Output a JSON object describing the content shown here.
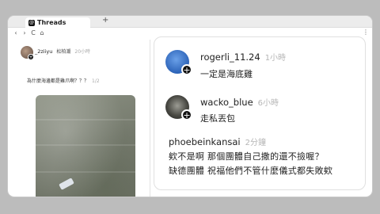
{
  "browser": {
    "tab_title": "Threads",
    "tab_icon": "@",
    "new_tab": "+",
    "nav": [
      "‹",
      "›",
      "C",
      "⌂"
    ],
    "menu": "⋮"
  },
  "post": {
    "username": "_2ziiyu",
    "tag": "松柏潮",
    "time": "20小時",
    "text": "為什麼海邊都是雞爪啊？？？",
    "page": "1/2"
  },
  "comments": [
    {
      "username": "rogerli_11.24",
      "time": "1小時",
      "text": "一定是海底雞"
    },
    {
      "username": "wacko_blue",
      "time": "6小時",
      "text": "走私丟包"
    },
    {
      "username": "phoebeinkansai",
      "time": "2分鐘",
      "lines": [
        "欸不是啊 那個團體自己撒的還不撿喔？",
        "缺德團體 祝福他們不管什麼儀式都失敗欸"
      ]
    }
  ],
  "badge_plus": "+"
}
